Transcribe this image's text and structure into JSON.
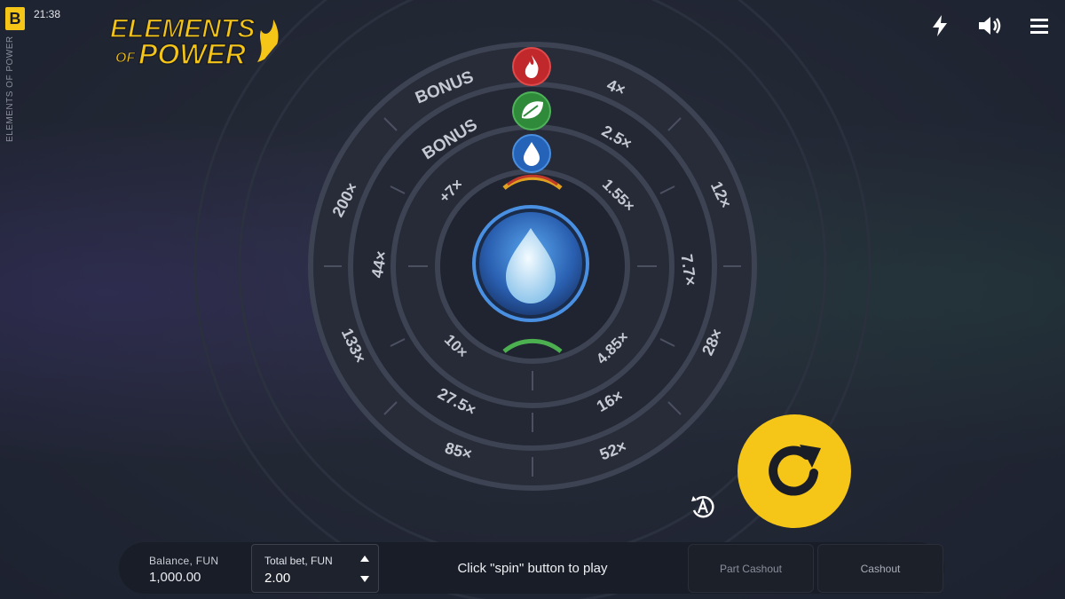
{
  "header": {
    "brand_letter": "B",
    "clock": "21:38",
    "vertical_title": "ELEMENTS OF POWER"
  },
  "logo": {
    "line1": "ELEMENTS",
    "line2a": "OF",
    "line2b": "POWER"
  },
  "top_icons": [
    "lightning-icon",
    "speaker-icon",
    "hamburger-menu-icon"
  ],
  "wheel": {
    "outer_ring": {
      "labels": [
        "BONUS",
        "4×",
        "12×",
        "28×",
        "52×",
        "85×",
        "133×",
        "200×"
      ]
    },
    "middle_ring": {
      "labels": [
        "BONUS",
        "2.5×",
        "7.7×",
        "16×",
        "27.5×",
        "44×"
      ]
    },
    "inner_ring": {
      "labels": [
        "+7×",
        "1.55×",
        "4.85×",
        "10×"
      ]
    },
    "element_markers": [
      "fire",
      "leaf",
      "water"
    ],
    "center_element": "water"
  },
  "colors": {
    "accent": "#f5c518",
    "fire": "#c0282c",
    "leaf": "#2f8a3a",
    "water": "#2463b8"
  },
  "bottom": {
    "balance_label": "Balance, FUN",
    "balance_value": "1,000.00",
    "bet_label": "Total bet, FUN",
    "bet_value": "2.00",
    "status": "Click \"spin\" button to play",
    "part_cashout": "Part Cashout",
    "cashout": "Cashout"
  }
}
